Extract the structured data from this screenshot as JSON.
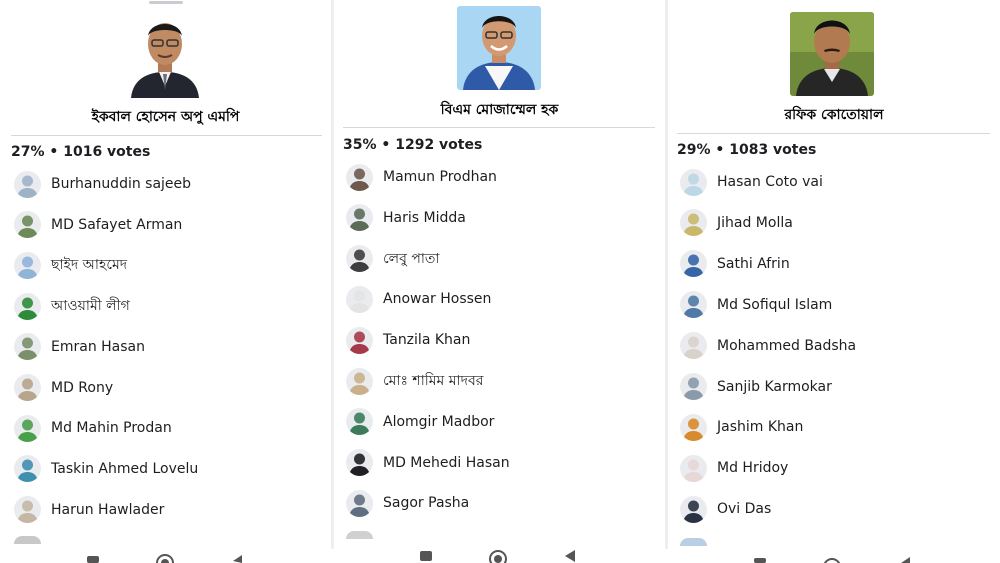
{
  "panels": [
    {
      "candidate": "ইকবাল হোসেন অপু এমপি",
      "percent": "27%",
      "votes": "1016 votes",
      "voters": [
        {
          "name": "Burhanuddin sajeeb",
          "color": "#9fb3c8"
        },
        {
          "name": "MD Safayet Arman",
          "color": "#6d8a5a"
        },
        {
          "name": "ছাইদ আহমেদ",
          "color": "#8fb4d8"
        },
        {
          "name": "আওয়ামী লীগ",
          "color": "#2e8b3a"
        },
        {
          "name": "Emran Hasan",
          "color": "#7a8f6a"
        },
        {
          "name": "MD Rony",
          "color": "#b7a58c"
        },
        {
          "name": "Md Mahin Prodan",
          "color": "#4aa04a"
        },
        {
          "name": "Taskin Ahmed Lovelu",
          "color": "#3f8fae"
        },
        {
          "name": "Harun Hawlader",
          "color": "#c4b7a4"
        }
      ]
    },
    {
      "candidate": "বিএম মোজাম্মেল হক",
      "percent": "35%",
      "votes": "1292 votes",
      "voters": [
        {
          "name": "Mamun Prodhan",
          "color": "#6e5a4c"
        },
        {
          "name": "Haris Midda",
          "color": "#5b6b58"
        },
        {
          "name": "লেবু পাতা",
          "color": "#3d3d3d"
        },
        {
          "name": "Anowar Hossen",
          "color": "#e4e4e4"
        },
        {
          "name": "Tanzila Khan",
          "color": "#a63a4a"
        },
        {
          "name": "মোঃ শামিম মাদবর",
          "color": "#c9b08a"
        },
        {
          "name": "Alomgir Madbor",
          "color": "#3c7c5a"
        },
        {
          "name": "MD Mehedi Hasan",
          "color": "#1f1f24"
        },
        {
          "name": "Sagor Pasha",
          "color": "#5f6f7f"
        }
      ]
    },
    {
      "candidate": "রফিক কোতোয়াল",
      "percent": "29%",
      "votes": "1083 votes",
      "voters": [
        {
          "name": "Hasan Coto vai",
          "color": "#bcd7e6"
        },
        {
          "name": "Jihad Molla",
          "color": "#c9b86a"
        },
        {
          "name": "Sathi Afrin",
          "color": "#3766a8"
        },
        {
          "name": "Md Sofiqul Islam",
          "color": "#4f7aa6"
        },
        {
          "name": "Mohammed Badsha",
          "color": "#d9d2cb"
        },
        {
          "name": "Sanjib Karmokar",
          "color": "#8a9aa8"
        },
        {
          "name": "Jashim Khan",
          "color": "#d98a2a"
        },
        {
          "name": "Md Hridoy",
          "color": "#e7d7d7"
        },
        {
          "name": "Ovi Das",
          "color": "#2a3344"
        }
      ]
    }
  ],
  "separator": "•",
  "icons": {
    "nav_home": "circle-home-icon",
    "nav_back": "triangle-back-icon",
    "nav_recent": "square-recents-icon"
  },
  "colors": {
    "text": "#1c1e21",
    "divider": "#d6d8dc",
    "background": "#ffffff"
  }
}
